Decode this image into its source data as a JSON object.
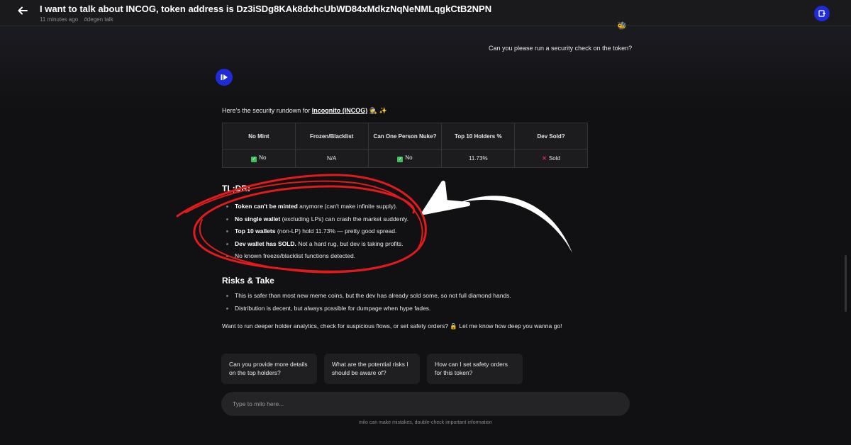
{
  "header": {
    "back_icon": "arrow-left-icon",
    "title": "I want to talk about INCOG, token address is Dz3iSDg8KAk8dxhcUbWD84xMdkzNqNeNMLqgkCtB2NPN",
    "time": "11 minutes ago",
    "tag": "#degen talk",
    "action_icon": "new-chat-icon"
  },
  "messages": {
    "user": "Can you please run a security check on the token?",
    "bot_intro_prefix": "Here's the security rundown for ",
    "bot_intro_link": "Incognito (INCOG)",
    "bot_intro_suffix": " 🕵️ ✨"
  },
  "table": {
    "headers": [
      "No Mint",
      "Frozen/Blacklist",
      "Can One Person Nuke?",
      "Top 10 Holders %",
      "Dev Sold?"
    ],
    "row": [
      "No",
      "N/A",
      "No",
      "11.73%",
      "Sold"
    ]
  },
  "tldr": {
    "heading": "TL;DR:",
    "items": [
      {
        "bold": "Token can't be minted",
        "rest": " anymore (can't make infinite supply)."
      },
      {
        "bold": "No single wallet",
        "rest": " (excluding LPs) can crash the market suddenly."
      },
      {
        "bold": "Top 10 wallets",
        "rest": " (non-LP) hold 11.73% — pretty good spread."
      },
      {
        "bold": "Dev wallet has SOLD.",
        "rest": " Not a hard rug, but dev is taking profits."
      },
      {
        "bold": "",
        "rest": "No known freeze/blacklist functions detected."
      }
    ]
  },
  "risks": {
    "heading": "Risks & Take",
    "items": [
      "This is safer than most new meme coins, but the dev has already sold some, so not full diamond hands.",
      "Distribution is decent, but always possible for dumpage when hype fades."
    ]
  },
  "closing": "Want to run deeper holder analytics, check for suspicious flows, or set safety orders? 🔒 Let me know how deep you wanna go!",
  "suggestions": [
    {
      "line1": "Can you provide more details",
      "line2": "on the top holders?"
    },
    {
      "line1": "What are the potential risks I",
      "line2": "should be aware of?"
    },
    {
      "line1": "How can I set safety orders",
      "line2": "for this token?"
    }
  ],
  "input": {
    "placeholder": "Type to milo here..."
  },
  "disclaimer": "milo can make mistakes, double-check important information",
  "colors": {
    "accent": "#1f2bd6",
    "annotation_red": "#e01b1b",
    "success": "#3fbf5a",
    "danger": "#e0245e"
  }
}
